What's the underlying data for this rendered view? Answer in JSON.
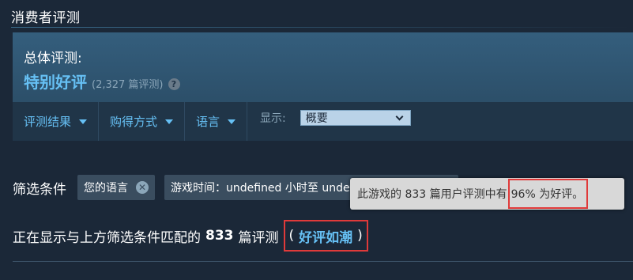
{
  "header": {
    "title": "消费者评测"
  },
  "summary": {
    "label": "总体评测:",
    "rating": "特别好评",
    "count": "(2,327 篇评测)",
    "help_glyph": "?"
  },
  "filter_menus": [
    {
      "label": "评测结果"
    },
    {
      "label": "购得方式"
    },
    {
      "label": "语言"
    }
  ],
  "display": {
    "label": "显示:",
    "selected": "概要"
  },
  "filters": {
    "label": "筛选条件",
    "chips": [
      {
        "label": "您的语言"
      },
      {
        "label": "游戏时间：undefined 小时至 undefined 小时"
      }
    ],
    "remove_glyph": "✕"
  },
  "tooltip": {
    "text_prefix": "此游戏的 833 篇用户评测中有 ",
    "text_highlight": "96% 为好评。"
  },
  "result": {
    "prefix": "正在显示与上方筛选条件匹配的",
    "count": "833",
    "suffix": "篇评测",
    "open_paren": "(",
    "rating": "好评如潮",
    "close_paren": ")"
  },
  "colors": {
    "background": "#1b2838",
    "accent": "#66c0f4",
    "highlight_border": "#e03a3a"
  }
}
